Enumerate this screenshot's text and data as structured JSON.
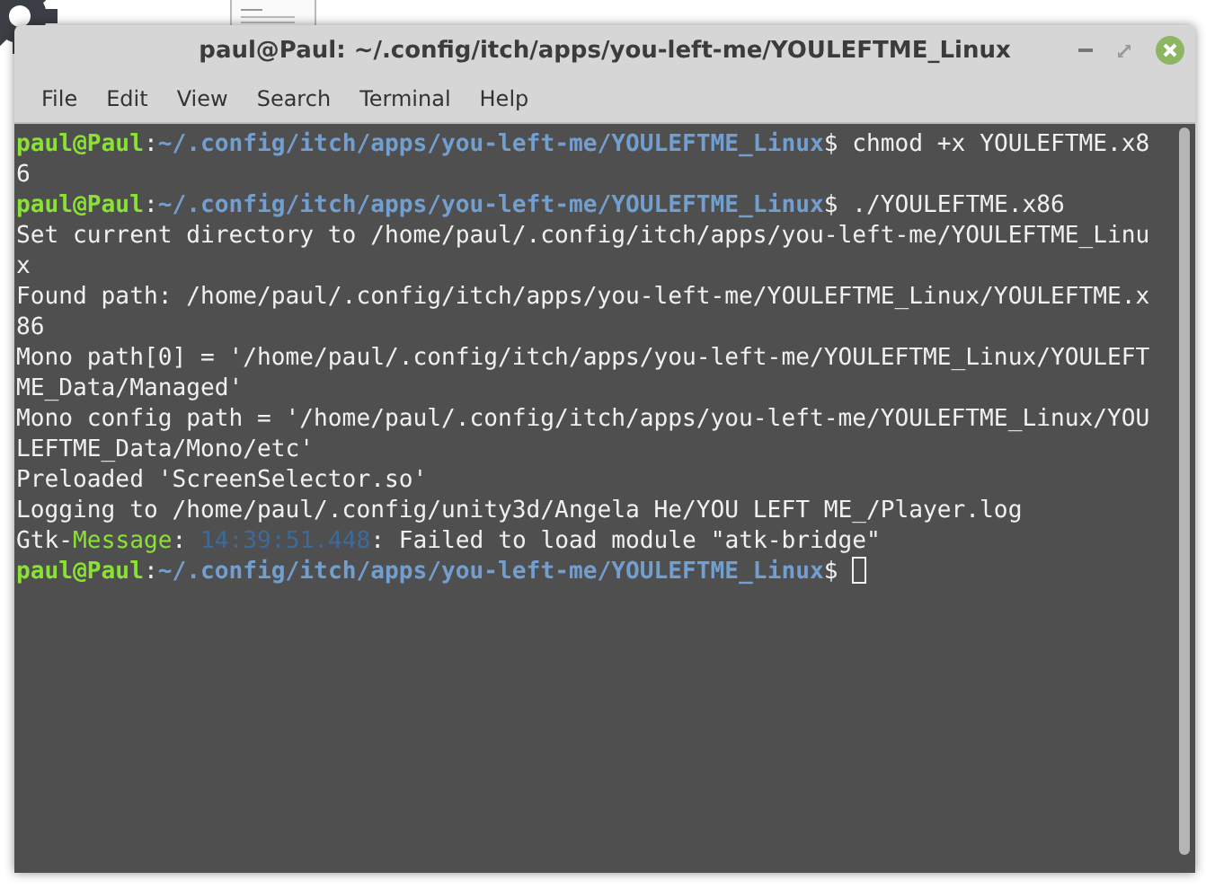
{
  "window": {
    "title": "paul@Paul: ~/.config/itch/apps/you-left-me/YOULEFTME_Linux"
  },
  "menu": [
    "File",
    "Edit",
    "View",
    "Search",
    "Terminal",
    "Help"
  ],
  "terminal": {
    "lines": [
      {
        "spans": [
          {
            "kind": "user",
            "text": "paul@Paul"
          },
          {
            "kind": "text",
            "text": ":"
          },
          {
            "kind": "path",
            "text": "~/.config/itch/apps/you-left-me/YOULEFTME_Linux"
          },
          {
            "kind": "text",
            "text": "$ chmod +x YOULEFTME.x8"
          }
        ]
      },
      {
        "spans": [
          {
            "kind": "text",
            "text": "6"
          }
        ]
      },
      {
        "spans": [
          {
            "kind": "user",
            "text": "paul@Paul"
          },
          {
            "kind": "text",
            "text": ":"
          },
          {
            "kind": "path",
            "text": "~/.config/itch/apps/you-left-me/YOULEFTME_Linux"
          },
          {
            "kind": "text",
            "text": "$ ./YOULEFTME.x86"
          }
        ]
      },
      {
        "spans": [
          {
            "kind": "text",
            "text": "Set current directory to /home/paul/.config/itch/apps/you-left-me/YOULEFTME_Linu"
          }
        ]
      },
      {
        "spans": [
          {
            "kind": "text",
            "text": "x"
          }
        ]
      },
      {
        "spans": [
          {
            "kind": "text",
            "text": "Found path: /home/paul/.config/itch/apps/you-left-me/YOULEFTME_Linux/YOULEFTME.x"
          }
        ]
      },
      {
        "spans": [
          {
            "kind": "text",
            "text": "86"
          }
        ]
      },
      {
        "spans": [
          {
            "kind": "text",
            "text": "Mono path[0] = '/home/paul/.config/itch/apps/you-left-me/YOULEFTME_Linux/YOULEFT"
          }
        ]
      },
      {
        "spans": [
          {
            "kind": "text",
            "text": "ME_Data/Managed'"
          }
        ]
      },
      {
        "spans": [
          {
            "kind": "text",
            "text": "Mono config path = '/home/paul/.config/itch/apps/you-left-me/YOULEFTME_Linux/YOU"
          }
        ]
      },
      {
        "spans": [
          {
            "kind": "text",
            "text": "LEFTME_Data/Mono/etc'"
          }
        ]
      },
      {
        "spans": [
          {
            "kind": "text",
            "text": "Preloaded 'ScreenSelector.so'"
          }
        ]
      },
      {
        "spans": [
          {
            "kind": "text",
            "text": "Logging to /home/paul/.config/unity3d/Angela He/YOU LEFT ME_/Player.log"
          }
        ]
      },
      {
        "spans": [
          {
            "kind": "text",
            "text": "Gtk-"
          },
          {
            "kind": "key",
            "text": "Message"
          },
          {
            "kind": "text",
            "text": ": "
          },
          {
            "kind": "time",
            "text": "14:39:51.448"
          },
          {
            "kind": "text",
            "text": ": Failed to load module \"atk-bridge\""
          }
        ]
      },
      {
        "spans": [
          {
            "kind": "user",
            "text": "paul@Paul"
          },
          {
            "kind": "text",
            "text": ":"
          },
          {
            "kind": "path",
            "text": "~/.config/itch/apps/you-left-me/YOULEFTME_Linux"
          },
          {
            "kind": "text",
            "text": "$ "
          },
          {
            "kind": "cursor"
          }
        ]
      }
    ]
  }
}
